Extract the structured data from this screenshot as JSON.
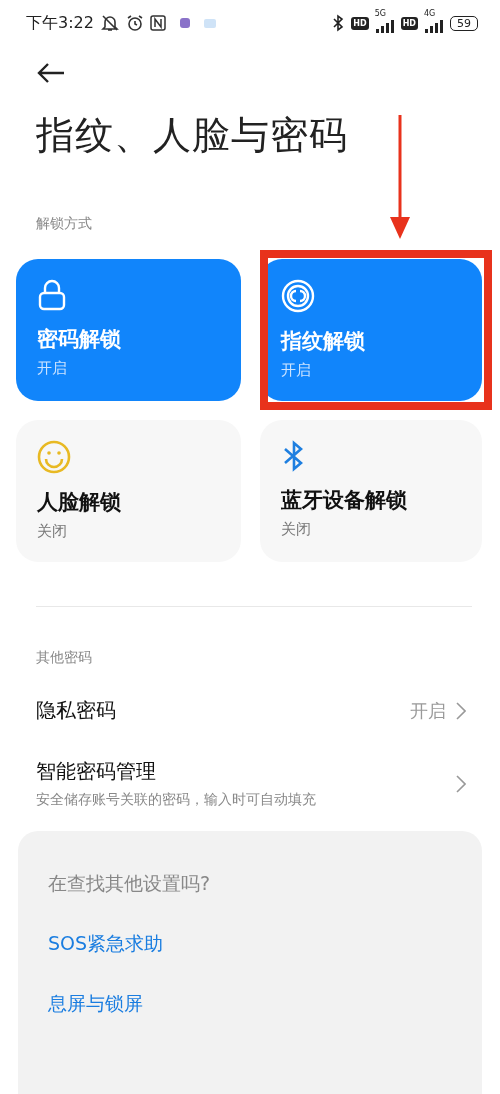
{
  "status_bar": {
    "time": "下午3:22",
    "network_1": {
      "hd": "HD",
      "type": "5G"
    },
    "network_2": {
      "hd": "HD",
      "type": "4G"
    },
    "battery": "59"
  },
  "title": "指纹、人脸与密码",
  "unlock_section": {
    "label": "解锁方式",
    "cards": [
      {
        "kind": "lock",
        "title": "密码解锁",
        "status": "开启",
        "on": true,
        "highlighted": false
      },
      {
        "kind": "fingerprint",
        "title": "指纹解锁",
        "status": "开启",
        "on": true,
        "highlighted": true
      },
      {
        "kind": "face",
        "title": "人脸解锁",
        "status": "关闭",
        "on": false,
        "highlighted": false
      },
      {
        "kind": "bluetooth",
        "title": "蓝牙设备解锁",
        "status": "关闭",
        "on": false,
        "highlighted": false
      }
    ]
  },
  "other_section": {
    "label": "其他密码",
    "rows": [
      {
        "title": "隐私密码",
        "value": "开启"
      },
      {
        "title": "智能密码管理",
        "subtitle": "安全储存账号关联的密码，输入时可自动填充"
      }
    ]
  },
  "suggestions": {
    "heading": "在查找其他设置吗?",
    "links": [
      "SOS紧急求助",
      "息屏与锁屏"
    ]
  }
}
